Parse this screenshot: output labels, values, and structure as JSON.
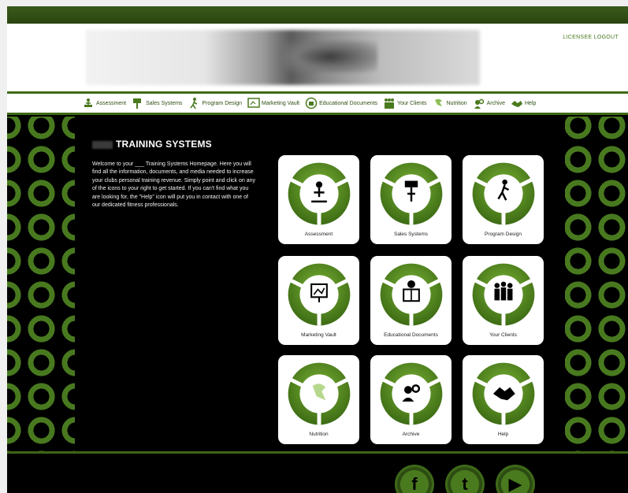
{
  "header": {
    "logout_label": "LICENSEE LOGOUT"
  },
  "nav": {
    "items": [
      {
        "label": "Assessment",
        "icon": "assessment-icon"
      },
      {
        "label": "Sales Systems",
        "icon": "sales-systems-icon"
      },
      {
        "label": "Program Design",
        "icon": "program-design-icon"
      },
      {
        "label": "Marketing Vault",
        "icon": "marketing-vault-icon"
      },
      {
        "label": "Educational Documents",
        "icon": "educational-documents-icon"
      },
      {
        "label": "Your Clients",
        "icon": "your-clients-icon"
      },
      {
        "label": "Nutrition",
        "icon": "nutrition-icon"
      },
      {
        "label": "Archive",
        "icon": "archive-icon"
      },
      {
        "label": "Help",
        "icon": "help-icon"
      }
    ]
  },
  "main": {
    "title": "TRAINING SYSTEMS",
    "intro": "Welcome to your ___ Training Systems Homepage. Here you will find all the information, documents, and media needed to increase your clubs personal training revenue. Simply point and click on any of the icons to your right to get started. If you can't find what you are looking for, the \"Help\" icon will put you in contact with one of our dedicated fitness professionals."
  },
  "tiles": [
    {
      "label": "Assessment",
      "icon": "assessment-icon"
    },
    {
      "label": "Sales Systems",
      "icon": "sales-systems-icon"
    },
    {
      "label": "Program Design",
      "icon": "program-design-icon"
    },
    {
      "label": "Marketing Vault",
      "icon": "marketing-vault-icon"
    },
    {
      "label": "Educational Documents",
      "icon": "educational-documents-icon"
    },
    {
      "label": "Your Clients",
      "icon": "your-clients-icon"
    },
    {
      "label": "Nutrition",
      "icon": "nutrition-icon"
    },
    {
      "label": "Archive",
      "icon": "archive-icon"
    },
    {
      "label": "Help",
      "icon": "help-icon"
    }
  ],
  "footer": {
    "social": [
      {
        "icon": "facebook-icon",
        "glyph": "f"
      },
      {
        "icon": "twitter-icon",
        "glyph": "t"
      },
      {
        "icon": "youtube-icon",
        "glyph": "▶"
      }
    ]
  },
  "colors": {
    "brand_green": "#4a7a1e",
    "dark_green": "#2d4c11",
    "background": "#000000"
  }
}
